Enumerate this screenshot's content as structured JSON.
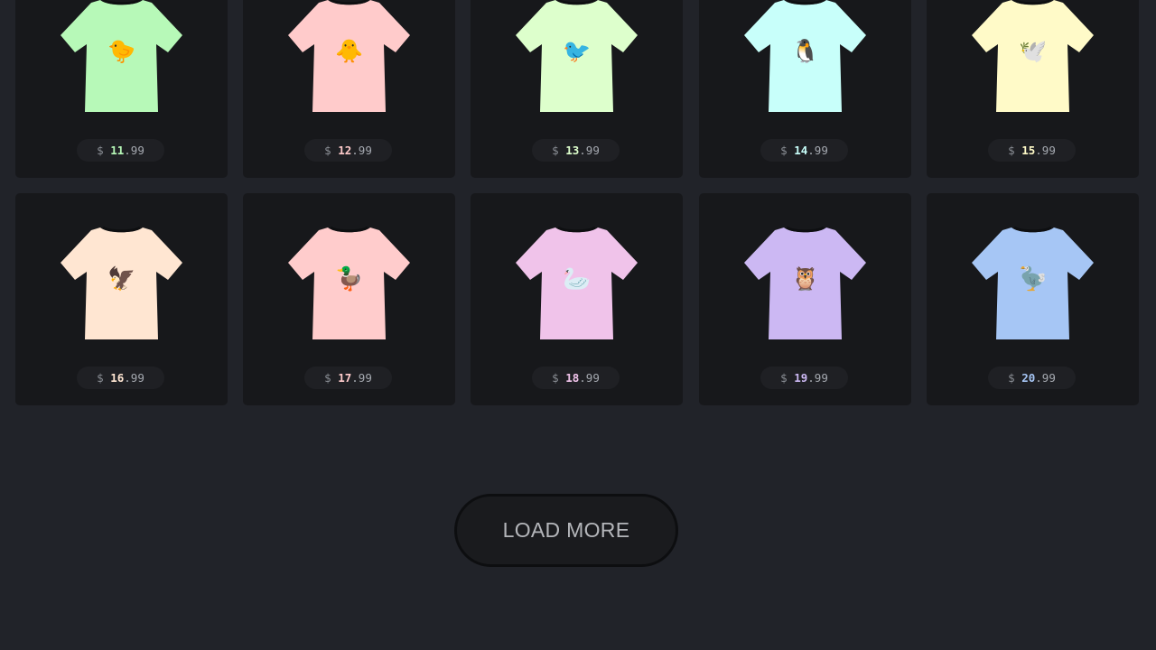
{
  "currency_symbol": "$",
  "products": [
    {
      "icon": "chick-head-icon",
      "emoji": "🐤",
      "price_int": "11",
      "price_cents": ".99",
      "shirt_color": "#b7f9b8",
      "price_color": "#b7f9b8"
    },
    {
      "icon": "hatching-chick-icon",
      "emoji": "🐥",
      "price_int": "12",
      "price_cents": ".99",
      "shirt_color": "#ffcbcb",
      "price_color": "#ffcbcb"
    },
    {
      "icon": "bird-icon",
      "emoji": "🐦",
      "price_int": "13",
      "price_cents": ".99",
      "shirt_color": "#ddffcc",
      "price_color": "#ddffcc"
    },
    {
      "icon": "penguin-icon",
      "emoji": "🐧",
      "price_int": "14",
      "price_cents": ".99",
      "shirt_color": "#c8fffa",
      "price_color": "#c8fffa"
    },
    {
      "icon": "dove-icon",
      "emoji": "🕊️",
      "price_int": "15",
      "price_cents": ".99",
      "shirt_color": "#fffac8",
      "price_color": "#fffac8"
    },
    {
      "icon": "eagle-icon",
      "emoji": "🦅",
      "price_int": "16",
      "price_cents": ".99",
      "shirt_color": "#ffe6d2",
      "price_color": "#ffe6d2"
    },
    {
      "icon": "duck-icon",
      "emoji": "🦆",
      "price_int": "17",
      "price_cents": ".99",
      "shirt_color": "#ffcccc",
      "price_color": "#ffcccc"
    },
    {
      "icon": "swan-icon",
      "emoji": "🦢",
      "price_int": "18",
      "price_cents": ".99",
      "shirt_color": "#f0c3ea",
      "price_color": "#f0c3ea"
    },
    {
      "icon": "owl-icon",
      "emoji": "🦉",
      "price_int": "19",
      "price_cents": ".99",
      "shirt_color": "#ccb8f3",
      "price_color": "#ccb8f3"
    },
    {
      "icon": "dodo-icon",
      "emoji": "🦤",
      "price_int": "20",
      "price_cents": ".99",
      "shirt_color": "#a6c6f5",
      "price_color": "#a6c6f5"
    }
  ],
  "load_more_label": "LOAD MORE"
}
